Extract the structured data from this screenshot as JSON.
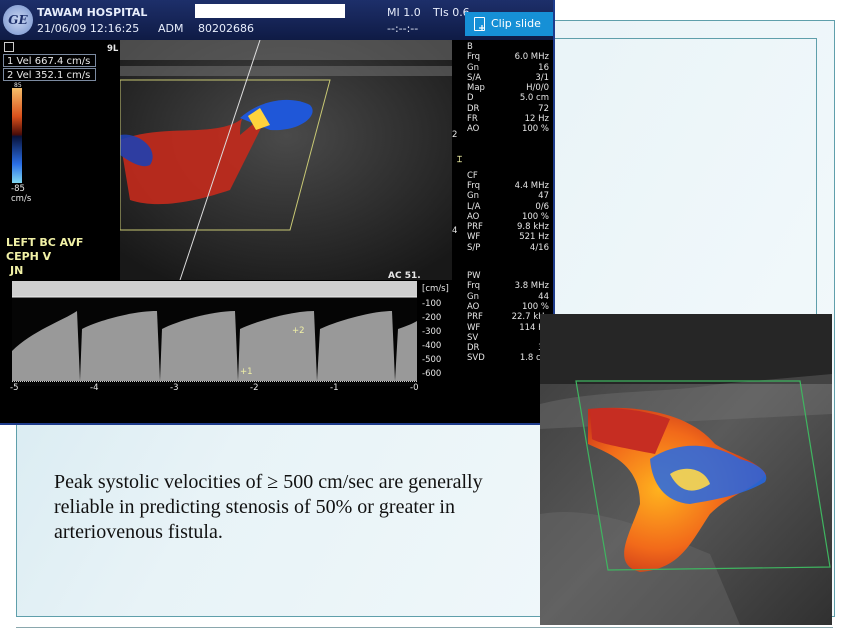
{
  "app": {
    "clip_button_label": "Clip slide",
    "clip_icon": "clip-slide-icon"
  },
  "ultrasound_top": {
    "logo": "GE",
    "hospital": "TAWAM HOSPITAL",
    "datetime": "21/06/09 12:16:25",
    "adm_label": "ADM",
    "patient_id": "80202686",
    "mi": "MI 1.0",
    "tis": "TIs 0.6",
    "tis_sub": "--:--:--",
    "velocities": [
      {
        "label": "1 Vel 667.4 cm/s"
      },
      {
        "label": "2 Vel 352.1 cm/s"
      }
    ],
    "color_scale_top": "85",
    "color_scale_bottom": "-85",
    "color_scale_unit": "cm/s",
    "probe_tag": "9L",
    "annotation_lines": [
      "LEFT BC AVF",
      "CEPH V",
      "JN"
    ],
    "ac_label": "AC 51.",
    "spectral_unit": "[cm/s]",
    "spectral_y_ticks": [
      "-100",
      "-200",
      "-300",
      "-400",
      "-500",
      "-600"
    ],
    "spectral_x_ticks": [
      "-5",
      "-4",
      "-3",
      "-2",
      "-1",
      "-0"
    ],
    "cursor_labels": [
      "1",
      "2"
    ],
    "params_b": [
      {
        "k": "B",
        "v": ""
      },
      {
        "k": "Frq",
        "v": "6.0 MHz"
      },
      {
        "k": "Gn",
        "v": "16"
      },
      {
        "k": "S/A",
        "v": "3/1"
      },
      {
        "k": "Map",
        "v": "H/0/0"
      },
      {
        "k": "D",
        "v": "5.0 cm"
      },
      {
        "k": "DR",
        "v": "72"
      },
      {
        "k": "FR",
        "v": "12 Hz"
      },
      {
        "k": "AO",
        "v": "100 %"
      }
    ],
    "params_cf": [
      {
        "k": "CF",
        "v": ""
      },
      {
        "k": "Frq",
        "v": "4.4 MHz"
      },
      {
        "k": "Gn",
        "v": "47"
      },
      {
        "k": "L/A",
        "v": "0/6"
      },
      {
        "k": "AO",
        "v": "100 %"
      },
      {
        "k": "PRF",
        "v": "9.8 kHz"
      },
      {
        "k": "WF",
        "v": "521 Hz"
      },
      {
        "k": "S/P",
        "v": "4/16"
      }
    ],
    "params_pw": [
      {
        "k": "PW",
        "v": ""
      },
      {
        "k": "Frq",
        "v": "3.8 MHz"
      },
      {
        "k": "Gn",
        "v": "44"
      },
      {
        "k": "AO",
        "v": "100 %"
      },
      {
        "k": "PRF",
        "v": "22.7 kHz"
      },
      {
        "k": "WF",
        "v": "114 Hz"
      },
      {
        "k": "SV",
        "v": "2"
      },
      {
        "k": "DR",
        "v": "36"
      },
      {
        "k": "SVD",
        "v": "1.8 cm"
      }
    ],
    "depth_markers": [
      "2",
      "4"
    ]
  },
  "caption": "Peak systolic velocities of ≥ 500 cm/sec are generally reliable in predicting stenosis of 50% or greater in arteriovenous fistula."
}
